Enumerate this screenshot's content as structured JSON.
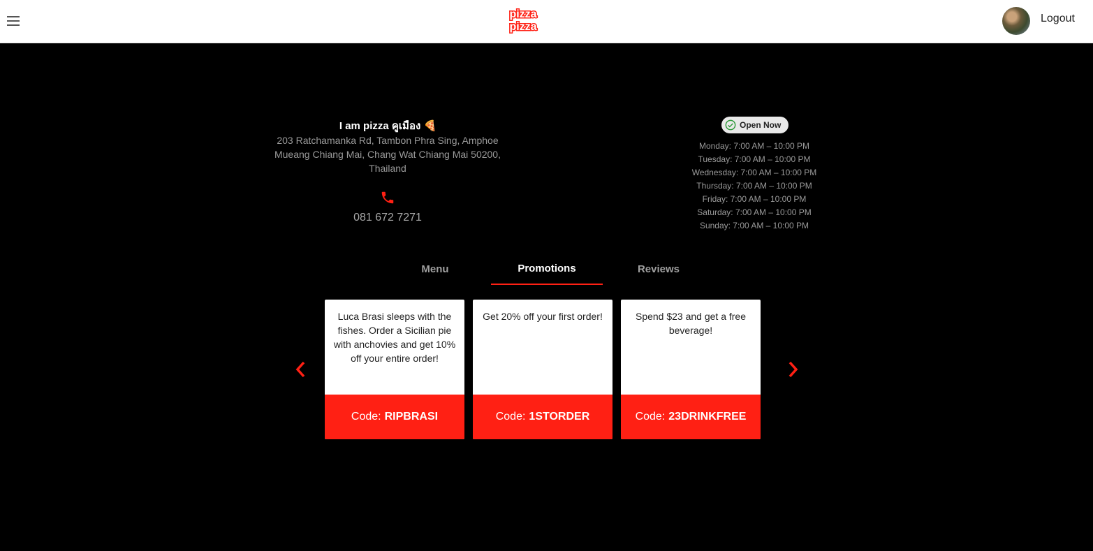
{
  "header": {
    "logo_text_top": "pizza",
    "logo_text_bottom": "pizza",
    "logout_label": "Logout"
  },
  "restaurant": {
    "name": "I am pizza คูเมือง 🍕",
    "address": "203 Ratchamanka Rd, Tambon Phra Sing, Amphoe Mueang Chiang Mai, Chang Wat Chiang Mai 50200, Thailand",
    "phone": "081 672 7271",
    "status": "Open Now",
    "hours": [
      "Monday: 7:00 AM – 10:00 PM",
      "Tuesday: 7:00 AM – 10:00 PM",
      "Wednesday: 7:00 AM – 10:00 PM",
      "Thursday: 7:00 AM – 10:00 PM",
      "Friday: 7:00 AM – 10:00 PM",
      "Saturday: 7:00 AM – 10:00 PM",
      "Sunday: 7:00 AM – 10:00 PM"
    ]
  },
  "tabs": [
    {
      "label": "Menu"
    },
    {
      "label": "Promotions"
    },
    {
      "label": "Reviews"
    }
  ],
  "promotions": [
    {
      "description": "Luca Brasi sleeps with the fishes. Order a Sicilian pie with anchovies and get 10% off your entire order!",
      "code_prefix": "Code:",
      "code": "RIPBRASI"
    },
    {
      "description": "Get 20% off your first order!",
      "code_prefix": "Code:",
      "code": "1STORDER"
    },
    {
      "description": "Spend $23 and get a free beverage!",
      "code_prefix": "Code:",
      "code": "23DRINKFREE"
    }
  ],
  "colors": {
    "accent": "#ff2014",
    "page_bg": "#000000",
    "header_bg": "#ffffff",
    "open_check": "#2e9a3a"
  }
}
